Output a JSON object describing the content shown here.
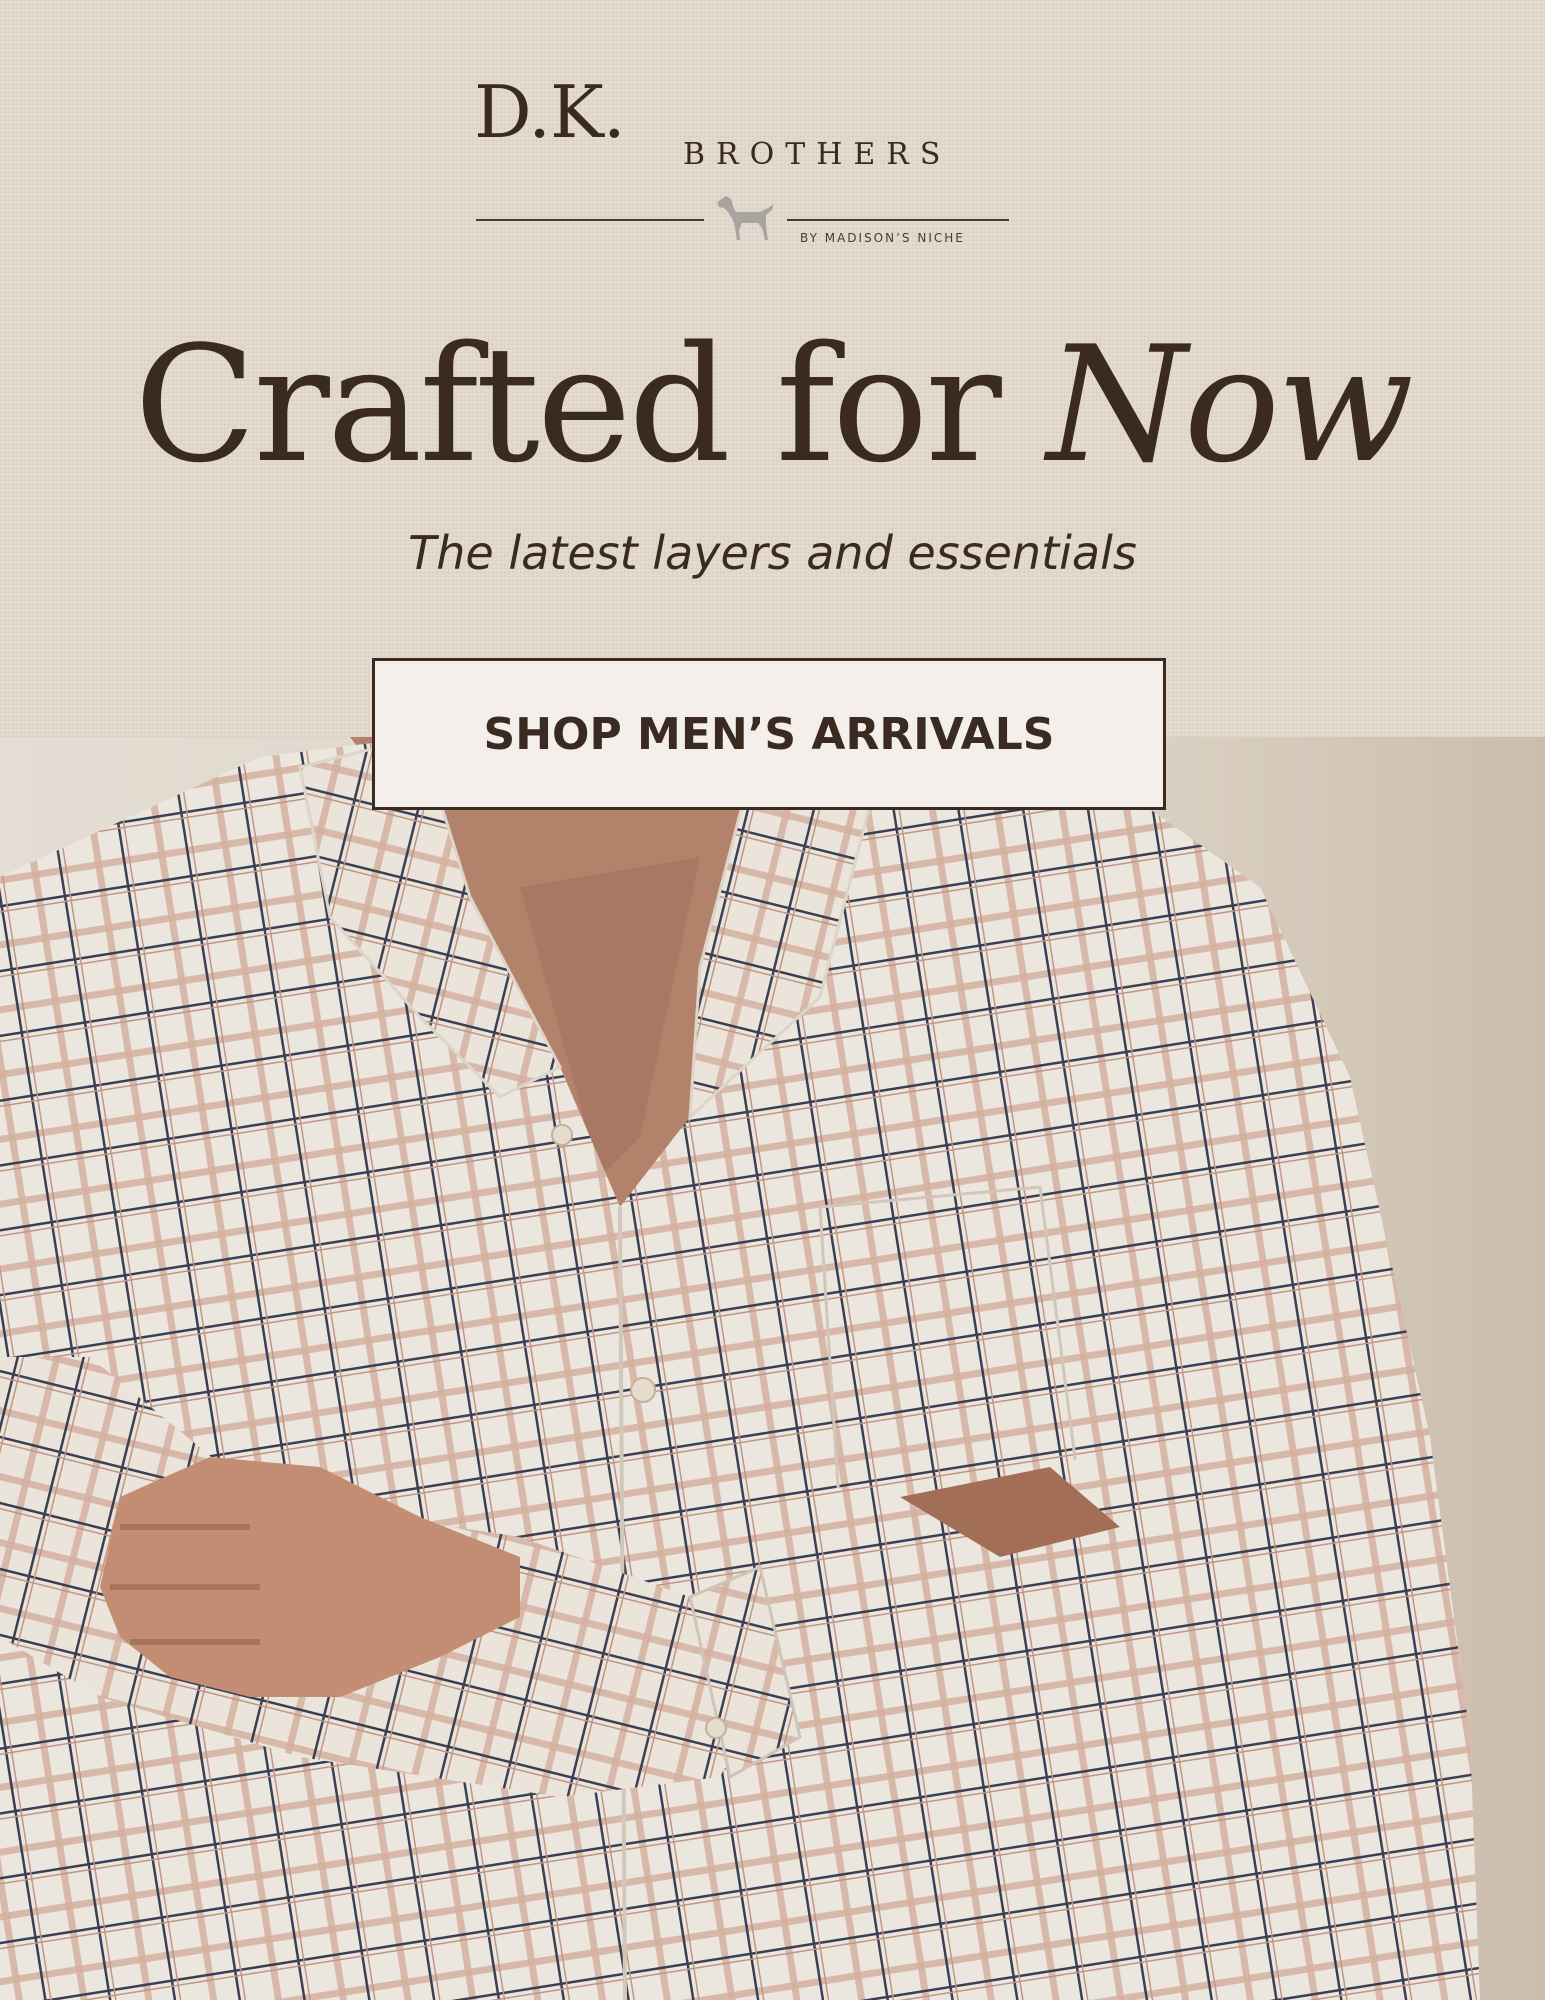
{
  "brand": {
    "name_primary": "D.K.",
    "name_secondary": "BROTHERS",
    "tagline": "BY MADISON’S NICHE"
  },
  "hero": {
    "headline_regular": "Crafted for ",
    "headline_italic": "Now",
    "subheadline": "The latest layers and essentials",
    "cta_label": "SHOP MEN’S ARRIVALS"
  },
  "colors": {
    "brand_brown": "#3a2a21",
    "linen_background": "#e3dbcf",
    "button_background": "#f4efeb",
    "photo_wall": "#e9e1d6"
  },
  "icons": {
    "logo_mark": "pointer-dog-icon"
  }
}
